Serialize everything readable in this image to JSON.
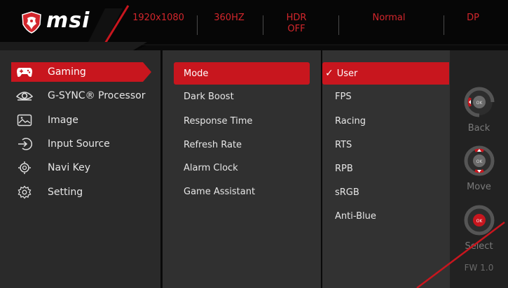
{
  "brand": {
    "logo_text": "msi"
  },
  "header": {
    "resolution": "1920x1080",
    "refresh": "360HZ",
    "hdr_line1": "HDR",
    "hdr_line2": "OFF",
    "mode": "Normal",
    "input": "DP"
  },
  "menu": [
    {
      "label": "Gaming",
      "icon": "gamepad-icon",
      "active": true
    },
    {
      "label": "G-SYNC® Processor",
      "icon": "gsync-eye-icon",
      "active": false
    },
    {
      "label": "Image",
      "icon": "image-icon",
      "active": false
    },
    {
      "label": "Input Source",
      "icon": "input-source-icon",
      "active": false
    },
    {
      "label": "Navi Key",
      "icon": "navi-key-icon",
      "active": false
    },
    {
      "label": "Setting",
      "icon": "gear-icon",
      "active": false
    }
  ],
  "submenu": [
    {
      "label": "Mode",
      "active": true
    },
    {
      "label": "Dark Boost",
      "active": false
    },
    {
      "label": "Response Time",
      "active": false
    },
    {
      "label": "Refresh Rate",
      "active": false
    },
    {
      "label": "Alarm Clock",
      "active": false
    },
    {
      "label": "Game Assistant",
      "active": false
    }
  ],
  "options": [
    {
      "label": "User",
      "selected": true
    },
    {
      "label": "FPS",
      "selected": false
    },
    {
      "label": "Racing",
      "selected": false
    },
    {
      "label": "RTS",
      "selected": false
    },
    {
      "label": "RPB",
      "selected": false
    },
    {
      "label": "sRGB",
      "selected": false
    },
    {
      "label": "Anti-Blue",
      "selected": false
    }
  ],
  "keys": {
    "back": "Back",
    "move": "Move",
    "select": "Select",
    "ok": "OK"
  },
  "firmware": "FW 1.0",
  "colors": {
    "accent": "#c8161e",
    "accent_text": "#d3262c",
    "panel": "#2a2a2a"
  }
}
